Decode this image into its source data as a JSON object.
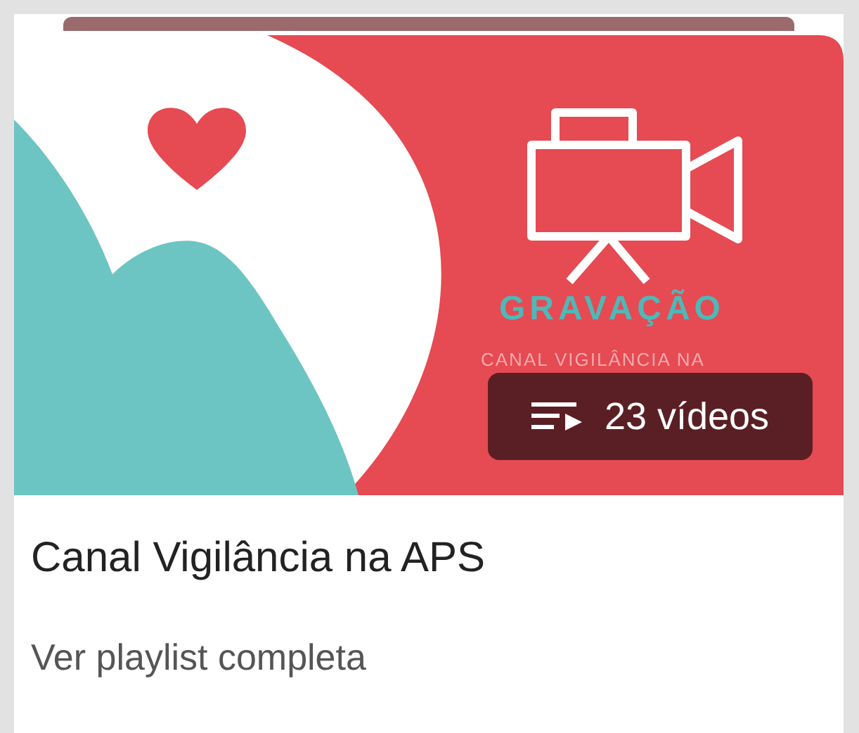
{
  "playlist": {
    "thumbnail": {
      "heading": "GRAVAÇÃO",
      "caption": "CANAL VIGILÂNCIA NA"
    },
    "video_count": "23 vídeos",
    "title": "Canal Vigilância na APS",
    "link": "Ver playlist completa"
  }
}
